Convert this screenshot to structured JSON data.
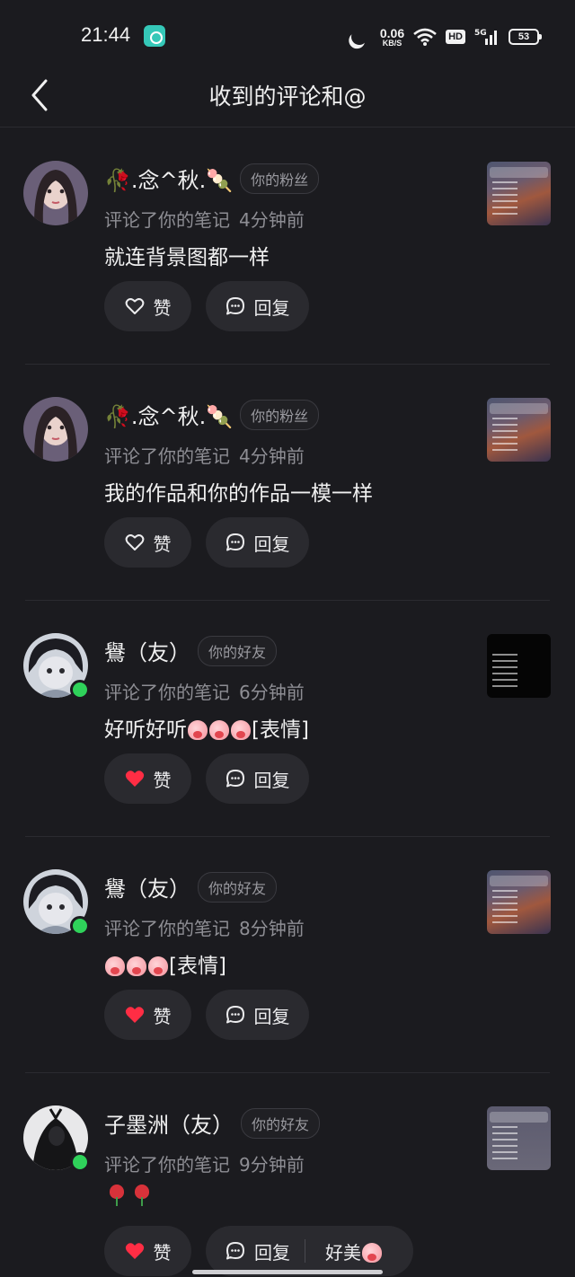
{
  "status_bar": {
    "time": "21:44",
    "network_speed": "0.06",
    "network_unit": "KB/S",
    "hd": "HD",
    "battery": "53",
    "icons": [
      "app-notification-icon",
      "moon-icon",
      "wifi-icon",
      "5g-signal-icon",
      "battery-icon"
    ]
  },
  "nav": {
    "title": "收到的评论和@",
    "back_icon": "chevron-left-icon"
  },
  "comments": [
    {
      "name": "🥀.念^秋.🍡",
      "badge": "你的粉丝",
      "action": "评论了你的笔记",
      "time": "4分钟前",
      "text": "就连背景图都一样",
      "like_label": "赞",
      "reply_label": "回复",
      "liked": false,
      "online": false,
      "thumb": "sky"
    },
    {
      "name": "🥀.念^秋.🍡",
      "badge": "你的粉丝",
      "action": "评论了你的笔记",
      "time": "4分钟前",
      "text": "我的作品和你的作品一模一样",
      "like_label": "赞",
      "reply_label": "回复",
      "liked": false,
      "online": false,
      "thumb": "sky"
    },
    {
      "name": "鸒（友）",
      "badge": "你的好友",
      "action": "评论了你的笔记",
      "time": "6分钟前",
      "text": "好听好听",
      "text_suffix": "[表情]",
      "emoji_count": 3,
      "like_label": "赞",
      "reply_label": "回复",
      "liked": true,
      "online": true,
      "thumb": "black"
    },
    {
      "name": "鸒（友）",
      "badge": "你的好友",
      "action": "评论了你的笔记",
      "time": "8分钟前",
      "text": "",
      "text_suffix": "[表情]",
      "emoji_count": 3,
      "like_label": "赞",
      "reply_label": "回复",
      "liked": true,
      "online": true,
      "thumb": "sky"
    },
    {
      "name": "子墨洲（友）",
      "badge": "你的好友",
      "action": "评论了你的笔记",
      "time": "9分钟前",
      "text": "",
      "rose_count": 2,
      "like_label": "赞",
      "reply_label": "回复",
      "quick_reply": "好美",
      "liked": true,
      "online": true,
      "thumb": "gray"
    }
  ],
  "colors": {
    "background": "#1b1b1f",
    "like_red": "#ff2d44",
    "online_green": "#2fd25a",
    "button_bg": "#2a2a2f"
  }
}
